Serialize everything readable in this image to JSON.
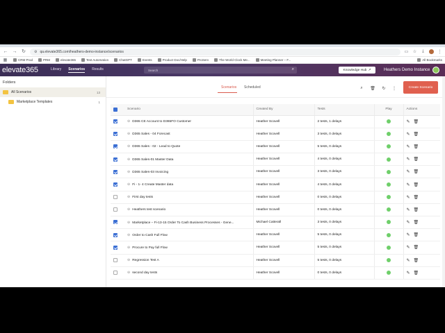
{
  "browser": {
    "url": "qa.elevate365.com/heathers-demo-instance/scenarios",
    "bookmarks": [
      "CRM Prod",
      "PRM",
      "elevate365",
      "Test Automation",
      "ChatGPT",
      "Events",
      "Product Doc/Help",
      "ProServ",
      "The World Clock Me...",
      "Meeting Planner – F..."
    ],
    "all_bookmarks": "All Bookmarks"
  },
  "app": {
    "logo": "elevate365",
    "nav": [
      "Library",
      "Scenarios",
      "Results"
    ],
    "active_nav": "Scenarios",
    "search_placeholder": "Search",
    "knowledge_hub": "Knowledge Hub",
    "instance_name": "Heathers Demo Instance"
  },
  "sidebar": {
    "title": "Folders",
    "folders": [
      {
        "label": "All Scenarios",
        "count": "13"
      },
      {
        "label": "Marketplace Templates",
        "count": "1"
      }
    ]
  },
  "tabs": [
    "Scenarios",
    "Scheduled"
  ],
  "create_button": "Create Scenario",
  "table": {
    "headers": {
      "name": "Scenario",
      "by": "Created By",
      "tests": "Tests",
      "play": "Play",
      "actions": "Actions"
    },
    "rows": [
      {
        "checked": true,
        "name": "D365 CE Account to D365FO Customer",
        "by": "Heather Scovell",
        "tests": "2 tests, 1 delays"
      },
      {
        "checked": true,
        "name": "D365 Sales - 04 Forecast",
        "by": "Heather Scovell",
        "tests": "3 tests, 0 delays"
      },
      {
        "checked": true,
        "name": "D365 Sales - 02 - Lead to Quote",
        "by": "Heather Scovell",
        "tests": "5 tests, 0 delays"
      },
      {
        "checked": true,
        "name": "D365 Sales-01 Master Data",
        "by": "Heather Scovell",
        "tests": "4 tests, 0 delays"
      },
      {
        "checked": true,
        "name": "D365 Sales-03 Invoicing",
        "by": "Heather Scovell",
        "tests": "3 tests, 0 delays"
      },
      {
        "checked": true,
        "name": "Fi - 1- 4 Create Master data",
        "by": "Heather Scovell",
        "tests": "4 tests, 0 delays"
      },
      {
        "checked": false,
        "name": "First day tests",
        "by": "Heather Scovell",
        "tests": "0 tests, 0 delays"
      },
      {
        "checked": false,
        "name": "Heathers test scenario",
        "by": "Heather Scovell",
        "tests": "0 tests, 0 delays"
      },
      {
        "checked": true,
        "name": "Marketplace – Fi-13-15 Order To Cash Business Processes - Gene...",
        "by": "Michael Catterall",
        "tests": "3 tests, 0 delays"
      },
      {
        "checked": true,
        "name": "Order to Cash Full Flow",
        "by": "Heather Scovell",
        "tests": "5 tests, 0 delays"
      },
      {
        "checked": true,
        "name": "Procure to Pay full Flow",
        "by": "Heather Scovell",
        "tests": "5 tests, 0 delays"
      },
      {
        "checked": false,
        "name": "Regression Test A",
        "by": "Heather Scovell",
        "tests": "5 tests, 0 delays"
      },
      {
        "checked": false,
        "name": "second day tests",
        "by": "Heather Scovell",
        "tests": "0 tests, 0 delays"
      }
    ]
  },
  "colors": {
    "accent": "#e0604f",
    "header_bg": "#4a3866",
    "check": "#3b6fd4",
    "play": "#6fcf6a"
  }
}
